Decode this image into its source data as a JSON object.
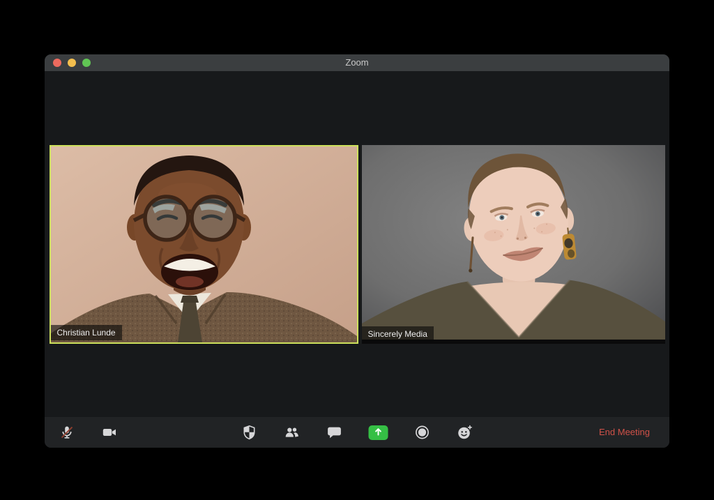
{
  "window": {
    "title": "Zoom"
  },
  "titlebar": {
    "traffic_lights": [
      {
        "name": "close",
        "color": "#ed6a5e"
      },
      {
        "name": "minimize",
        "color": "#f4bf4e"
      },
      {
        "name": "zoom-window",
        "color": "#61c554"
      }
    ]
  },
  "participants": [
    {
      "name": "Christian Lunde",
      "active_speaker": true
    },
    {
      "name": "Sincerely Media",
      "active_speaker": false
    }
  ],
  "toolbar": {
    "left_icons": [
      {
        "icon": "microphone-muted-icon",
        "state": "muted"
      },
      {
        "icon": "video-camera-icon",
        "state": "on"
      }
    ],
    "center_icons": [
      {
        "icon": "security-shield-icon"
      },
      {
        "icon": "participants-icon"
      },
      {
        "icon": "chat-bubble-icon"
      },
      {
        "icon": "share-screen-icon",
        "highlighted": true
      },
      {
        "icon": "record-icon"
      },
      {
        "icon": "reactions-smiley-icon"
      }
    ],
    "end_meeting_label": "End Meeting"
  },
  "colors": {
    "active_speaker_border": "#cde05c",
    "end_meeting_text": "#cf5148",
    "share_screen_green": "#35bf45",
    "titlebar_bg": "#3b3e40",
    "toolbar_bg": "#212325",
    "window_bg": "#17191b",
    "mic_muted_slash": "#93402f",
    "desktop_bg": "#000000"
  }
}
